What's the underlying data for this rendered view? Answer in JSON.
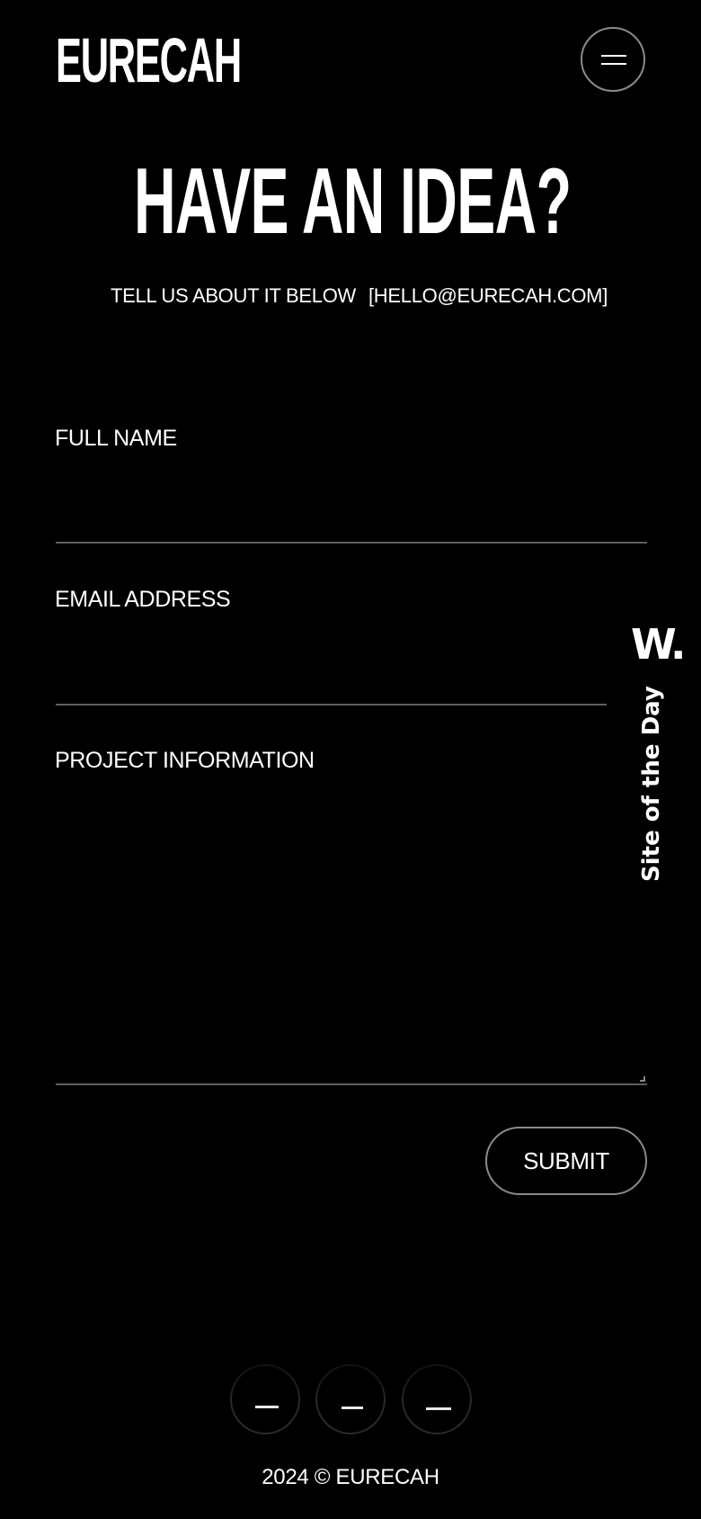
{
  "header": {
    "logo_text": "EURECAH",
    "menu_icon": "hamburger-icon"
  },
  "hero": {
    "headline": "HAVE AN IDEA?",
    "tagline": "TELL US ABOUT IT BELOW",
    "email_link": "[HELLO@EURECAH.COM]"
  },
  "form": {
    "full_name_label": "FULL NAME",
    "full_name_value": "",
    "email_label": "EMAIL ADDRESS",
    "email_value": "",
    "project_label": "PROJECT INFORMATION",
    "project_value": "",
    "submit_label": "SUBMIT"
  },
  "award": {
    "mark": "W.",
    "text": "Site of the Day"
  },
  "footer": {
    "social_icons": [
      "social-icon-1",
      "social-icon-2",
      "social-icon-3"
    ],
    "copyright": "2024 © EURECAH"
  },
  "colors": {
    "background": "#000000",
    "text": "#ffffff",
    "border": "#8a8a8a",
    "underline": "#5e5e5e"
  }
}
